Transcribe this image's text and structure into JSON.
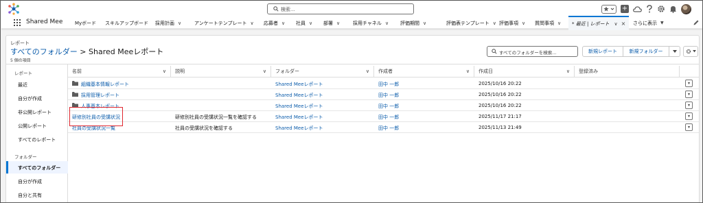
{
  "header": {
    "search_placeholder": "検索...",
    "app_name": "Shared Mee"
  },
  "nav": {
    "items": [
      {
        "label": "Myボード",
        "has_menu": false
      },
      {
        "label": "スキルアップボード",
        "has_menu": false
      },
      {
        "label": "採用計画",
        "has_menu": true
      },
      {
        "label": "アンケートテンプレート",
        "has_menu": true
      },
      {
        "label": "応募者",
        "has_menu": true
      },
      {
        "label": "社員",
        "has_menu": true
      },
      {
        "label": "部署",
        "has_menu": true
      },
      {
        "label": "採用チャネル",
        "has_menu": true
      },
      {
        "label": "評価期間",
        "has_menu": true
      },
      {
        "label": "評価表テンプレート",
        "has_menu": true
      },
      {
        "label": "評価事項",
        "has_menu": true
      },
      {
        "label": "質問事項",
        "has_menu": true
      }
    ],
    "active_tab": "* 最近 | レポート",
    "more": "さらに表示"
  },
  "page": {
    "object_label": "レポート",
    "breadcrumb_root": "すべてのフォルダー",
    "breadcrumb_sep": ">",
    "title": "Shared Meeレポート",
    "item_count": "5 個の項目",
    "folder_search_placeholder": "すべてのフォルダーを検索...",
    "new_report": "新規レポート",
    "new_folder": "新規フォルダー"
  },
  "sidebar": {
    "reports_section": "レポート",
    "report_items": [
      "最近",
      "自分が作成",
      "非公開レポート",
      "公開レポート",
      "すべてのレポート"
    ],
    "folders_section": "フォルダー",
    "folder_items": [
      "すべてのフォルダー",
      "自分が作成",
      "自分と共有"
    ],
    "selected_folder": "すべてのフォルダー"
  },
  "table": {
    "columns": [
      "名前",
      "説明",
      "フォルダー",
      "作成者",
      "作成日",
      "登録済み"
    ],
    "rows": [
      {
        "name": "組織基本情報レポート",
        "is_folder": true,
        "description": "",
        "folder": "Shared Meeレポート",
        "creator": "田中 一郎",
        "created": "2025/10/16 20:22"
      },
      {
        "name": "採用管理レポート",
        "is_folder": true,
        "description": "",
        "folder": "Shared Meeレポート",
        "creator": "田中 一郎",
        "created": "2025/10/16 20:22"
      },
      {
        "name": "人事基本レポート",
        "is_folder": true,
        "description": "",
        "folder": "Shared Meeレポート",
        "creator": "田中 一郎",
        "created": "2025/10/16 20:22"
      },
      {
        "name": "研修別社員の受講状況",
        "is_folder": false,
        "description": "研修別社員の受講状況一覧を確認する",
        "folder": "Shared Meeレポート",
        "creator": "田中 一郎",
        "created": "2025/11/17 21:17"
      },
      {
        "name": "社員の受講状況一覧",
        "is_folder": false,
        "description": "社員の受講状況を確認する",
        "folder": "Shared Meeレポート",
        "creator": "田中 一郎",
        "created": "2025/11/13 21:49"
      }
    ]
  },
  "colors": {
    "brand_blue": "#0176d3",
    "link": "#0b5cab",
    "highlight_box": "#e0262e"
  }
}
